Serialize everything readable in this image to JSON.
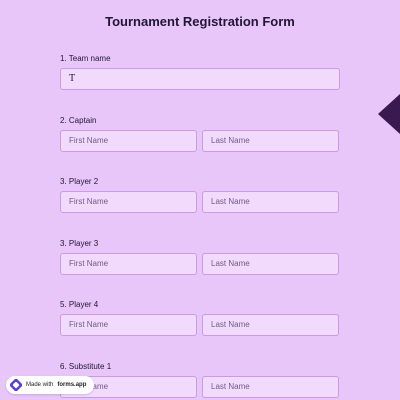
{
  "form": {
    "title": "Tournament Registration Form",
    "team": {
      "label": "1. Team name",
      "value": "T"
    },
    "players": [
      {
        "label": "2. Captain",
        "first_placeholder": "First Name",
        "last_placeholder": "Last Name"
      },
      {
        "label": "3. Player 2",
        "first_placeholder": "First Name",
        "last_placeholder": "Last Name"
      },
      {
        "label": "3. Player 3",
        "first_placeholder": "First Name",
        "last_placeholder": "Last Name"
      },
      {
        "label": "5. Player 4",
        "first_placeholder": "First Name",
        "last_placeholder": "Last Name"
      },
      {
        "label": "6. Substitute 1",
        "first_placeholder": "First Name",
        "last_placeholder": "Last Name"
      }
    ]
  },
  "badge": {
    "prefix": "Made with",
    "site": "forms.app"
  },
  "colors": {
    "background": "#e8c6fa",
    "input_bg": "#f2dafd",
    "input_border": "#c99be3",
    "side_tab": "#3a1850"
  },
  "icons": {
    "badge_logo": "forms-app-logo-icon",
    "side_tab": "side-tab-toggle-icon"
  }
}
